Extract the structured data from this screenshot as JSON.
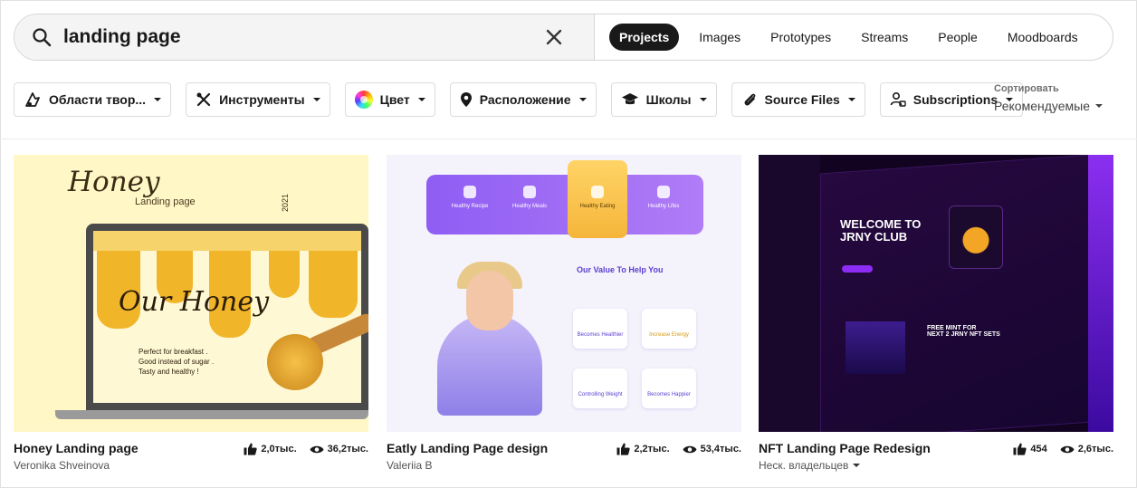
{
  "search": {
    "query": "landing page",
    "tabs": [
      "Projects",
      "Images",
      "Prototypes",
      "Streams",
      "People",
      "Moodboards"
    ],
    "active_tab": "Projects"
  },
  "filters": [
    {
      "label": "Области твор...",
      "icon": "creative-fields-icon"
    },
    {
      "label": "Инструменты",
      "icon": "tools-icon"
    },
    {
      "label": "Цвет",
      "icon": "color-wheel-icon"
    },
    {
      "label": "Расположение",
      "icon": "location-pin-icon"
    },
    {
      "label": "Школы",
      "icon": "graduation-cap-icon"
    },
    {
      "label": "Source Files",
      "icon": "paperclip-icon"
    },
    {
      "label": "Subscriptions",
      "icon": "subscriptions-icon"
    }
  ],
  "sort": {
    "label": "Сортировать",
    "value": "Рекомендуемые"
  },
  "cards": [
    {
      "title": "Honey Landing page",
      "owner": "Veronika Shveinova",
      "likes": "2,0тыс.",
      "views": "36,2тыс.",
      "thumb": {
        "headline": "Honey",
        "subline": "Landing page",
        "year": "2021",
        "hero": "Our Honey",
        "tagline": "Perfect for breakfast .\nGood instead of sugar .\nTasty and healthy !"
      }
    },
    {
      "title": "Eatly Landing Page design",
      "owner": "Valeriia B",
      "likes": "2,2тыс.",
      "views": "53,4тыс.",
      "thumb": {
        "cols": [
          "Healthy Recipe",
          "Healthy Meals",
          "Healthy Eating",
          "Healthy Lifes"
        ],
        "value": "Our Value To Help You",
        "features": [
          "Becomes Healthier",
          "Increase Energy",
          "Controlling Weight",
          "Becomes Happier"
        ]
      }
    },
    {
      "title": "NFT Landing Page Redesign",
      "owner": "Неск. владельцев",
      "likes": "454",
      "views": "2,6тыс.",
      "thumb": {
        "welcome": "WELCOME TO\nJRNY CLUB",
        "mint": "FREE MINT FOR\nNEXT 2 JRNY NFT SETS"
      }
    }
  ],
  "colors": {
    "accent": "#191919",
    "honey": "#f1b52a",
    "eatly": "#8f5df3",
    "nft": "#8d2cf4"
  }
}
